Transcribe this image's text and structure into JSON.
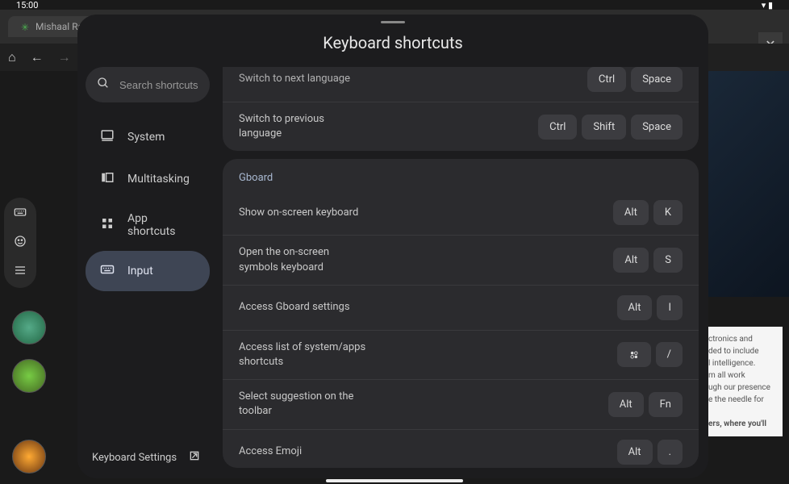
{
  "statusBar": {
    "time": "15:00"
  },
  "browser": {
    "tabTitle": "Mishaal Rahn",
    "closeSymbol": "✕"
  },
  "modal": {
    "title": "Keyboard shortcuts",
    "search": {
      "placeholder": "Search shortcuts"
    },
    "sidebar": {
      "items": [
        {
          "label": "System"
        },
        {
          "label": "Multitasking"
        },
        {
          "label": "App shortcuts"
        },
        {
          "label": "Input"
        }
      ],
      "footer": "Keyboard Settings"
    },
    "sections": [
      {
        "cutoffTop": true,
        "rows": [
          {
            "label": "Switch to next language",
            "keys": [
              "Ctrl",
              "Space"
            ],
            "cutoff": true
          },
          {
            "label": "Switch to previous language",
            "keys": [
              "Ctrl",
              "Shift",
              "Space"
            ]
          }
        ]
      },
      {
        "header": "Gboard",
        "rows": [
          {
            "label": "Show on-screen keyboard",
            "keys": [
              "Alt",
              "K"
            ]
          },
          {
            "label": "Open the on-screen symbols keyboard",
            "keys": [
              "Alt",
              "S"
            ]
          },
          {
            "label": "Access Gboard settings",
            "keys": [
              "Alt",
              "I"
            ]
          },
          {
            "label": "Access list of system/apps shortcuts",
            "keys": [
              "__icon_apps",
              "/"
            ]
          },
          {
            "label": "Select suggestion on the toolbar",
            "keys": [
              "Alt",
              "Fn"
            ]
          },
          {
            "label": "Access Emoji",
            "keys": [
              "Alt",
              "."
            ],
            "cutoffBottom": true
          }
        ]
      }
    ]
  },
  "bgTextLines": [
    "ctronics and",
    "ded to include",
    "l intelligence.",
    "m all work",
    "ugh our presence",
    "e the needle for",
    "",
    "ers, where you'll"
  ]
}
